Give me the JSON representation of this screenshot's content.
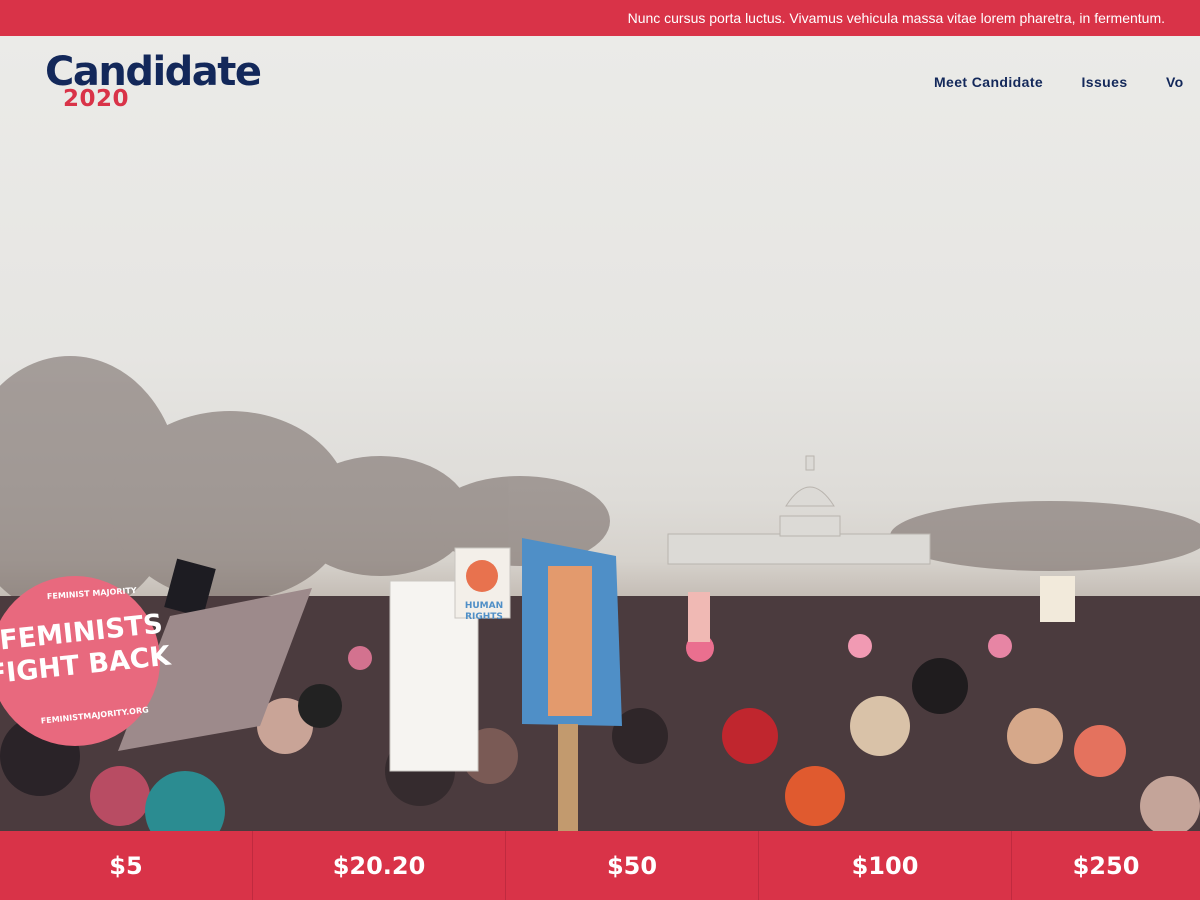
{
  "topbar": {
    "announcement": "Nunc cursus porta luctus. Vivamus vehicula massa vitae lorem pharetra, in fermentum."
  },
  "logo": {
    "name": "Candidate",
    "year": "2020"
  },
  "nav": {
    "items": [
      {
        "label": "Meet Candidate"
      },
      {
        "label": "Issues"
      },
      {
        "label": "Vo"
      }
    ]
  },
  "hero": {
    "signs": {
      "feminists_line1": "FEMINISTS",
      "feminists_line2": "FIGHT BACK",
      "feminist_majority": "FEMINIST MAJORITY",
      "feminist_url": "FEMINISTMAJORITY.ORG",
      "human_rights_line1": "HUMAN",
      "human_rights_line2": "RIGHTS"
    }
  },
  "donate": {
    "amounts": [
      "$5",
      "$20.20",
      "$50",
      "$100",
      "$250"
    ]
  },
  "colors": {
    "brand_red": "#d93348",
    "brand_navy": "#13285a"
  }
}
